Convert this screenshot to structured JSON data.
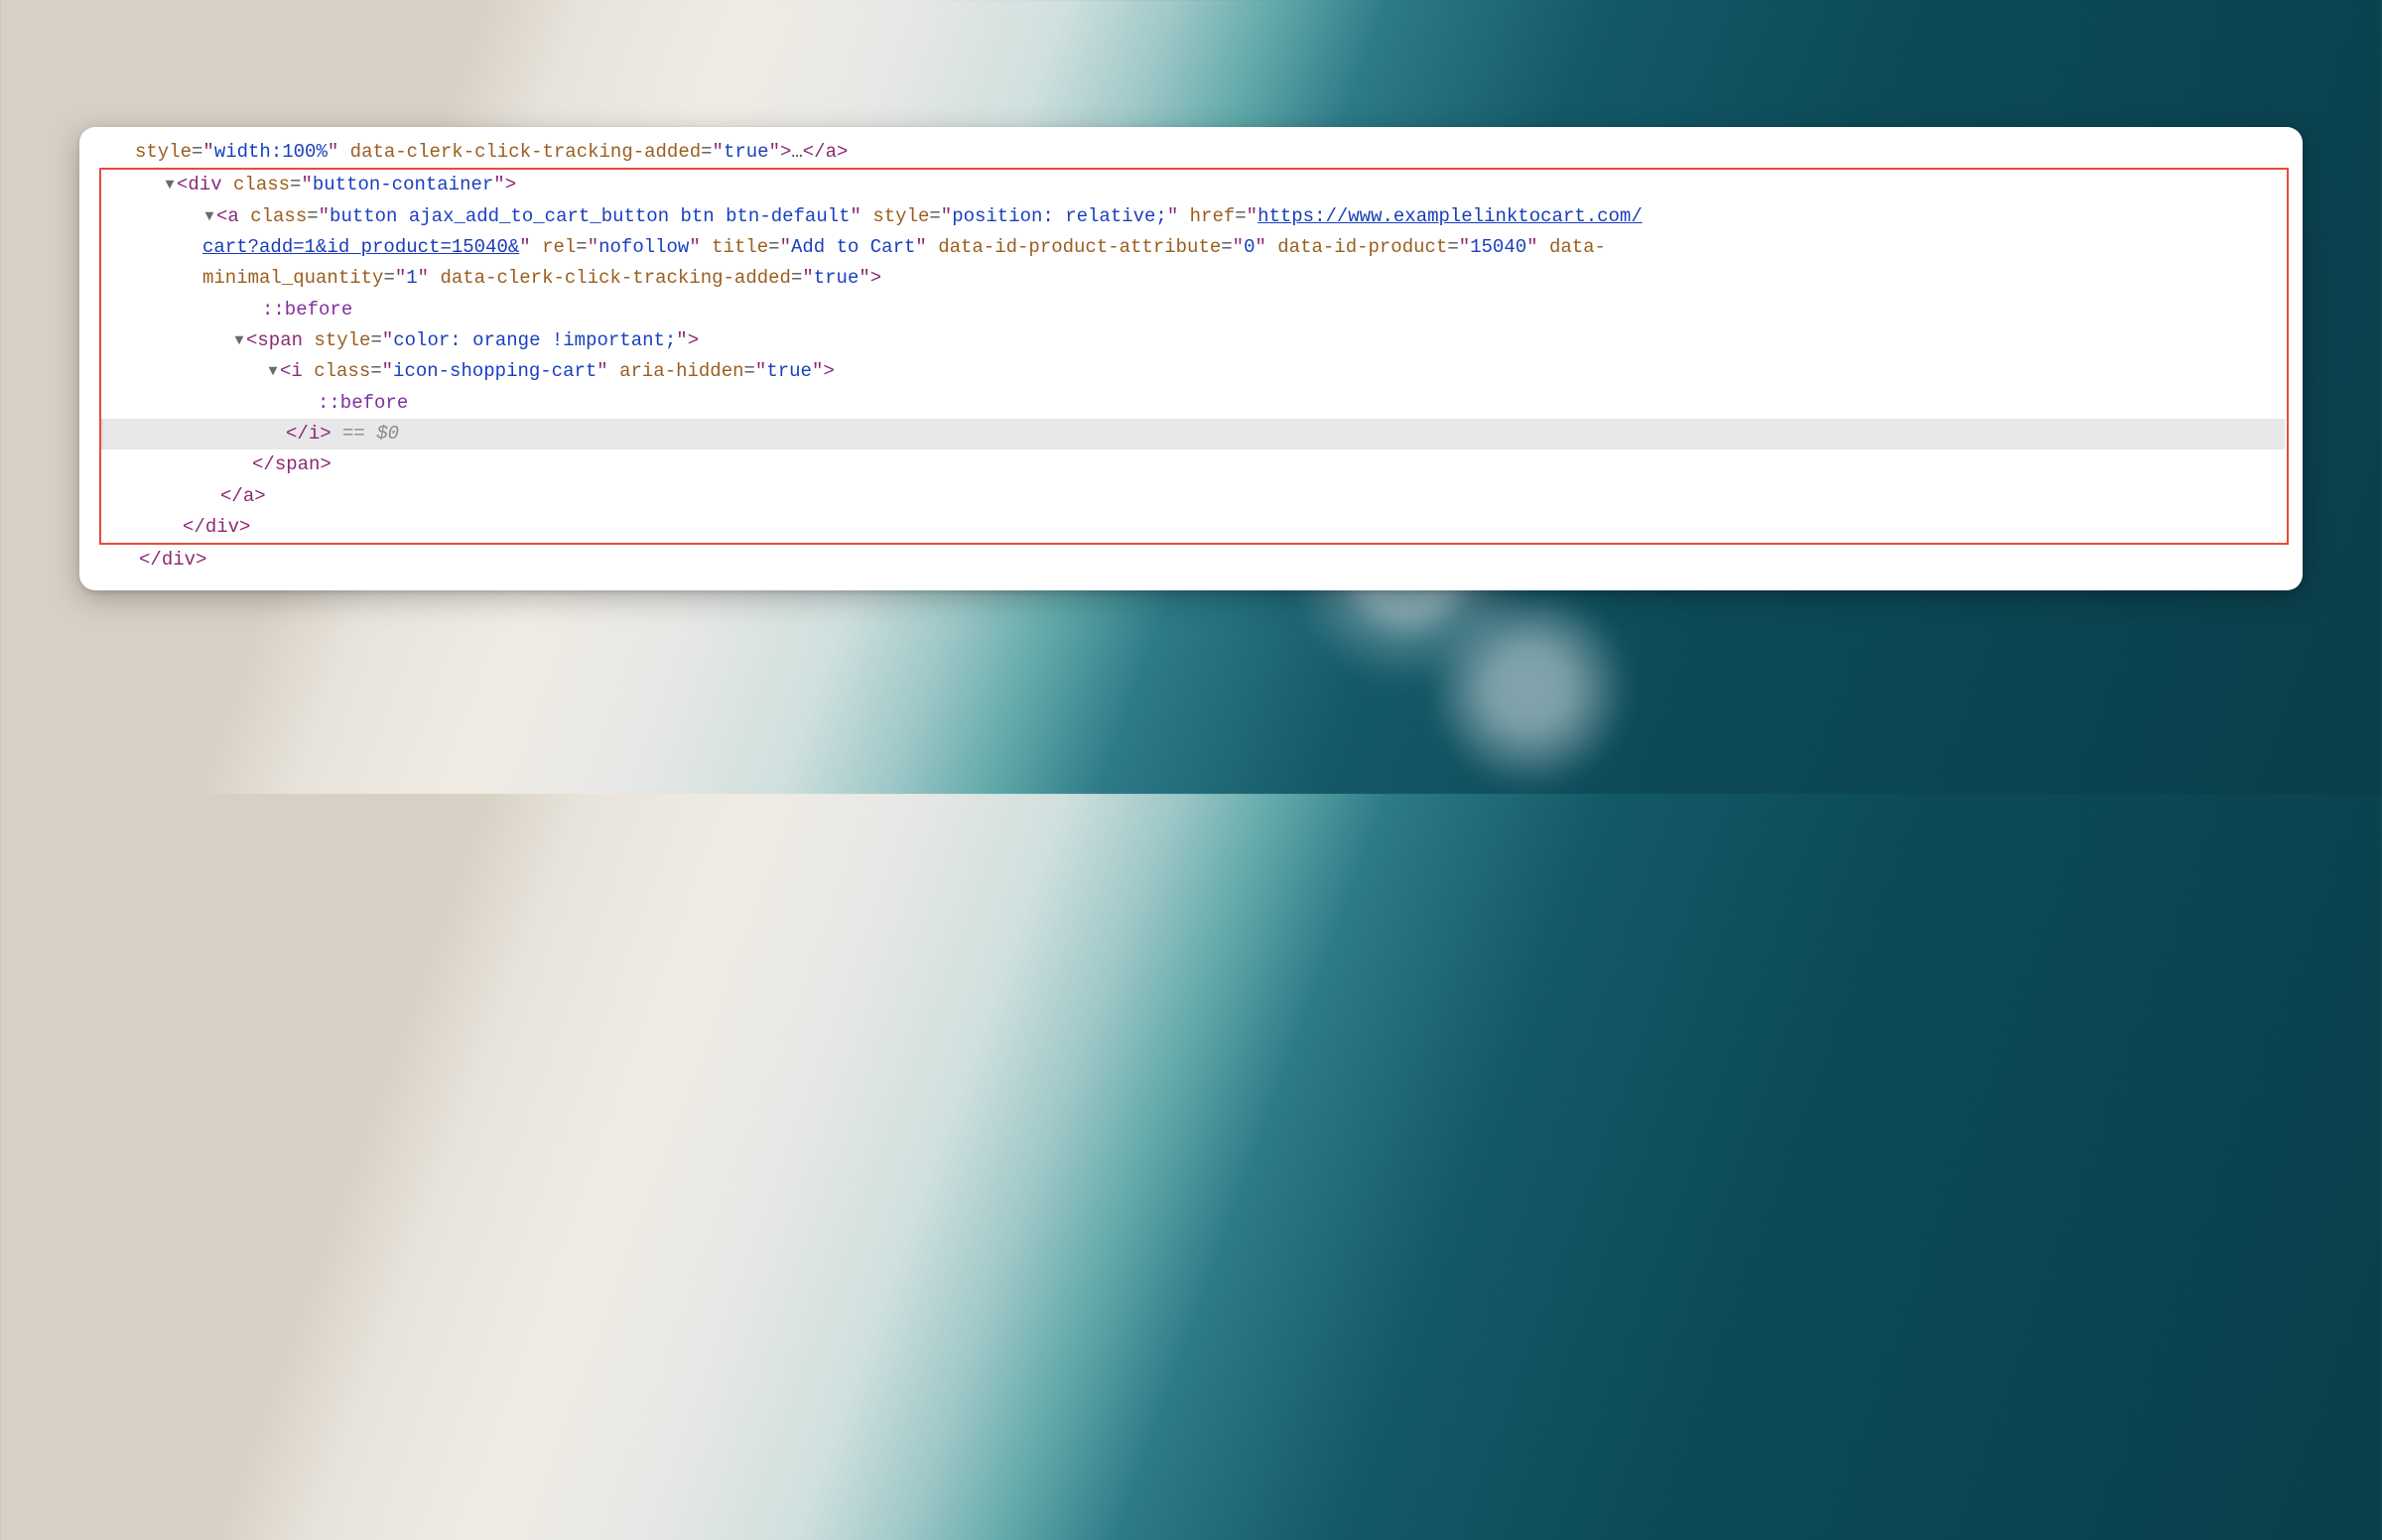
{
  "colors": {
    "tag": "#8a2a76",
    "attr": "#9b5e1e",
    "string": "#1a3fbf",
    "link": "#193db8",
    "pseudo": "#8030a0",
    "gray": "#8a8a8a",
    "highlightBorder": "#e94b3c",
    "selectedRowBg": "#e8e8e8"
  },
  "toggles": {
    "divButtonContainer": "▼",
    "anchor": "▼",
    "span": "▼",
    "iTag": "▼"
  },
  "line0": {
    "attr_style": "style",
    "val_style": "width:100%",
    "attr_tracking": "data-clerk-click-tracking-added",
    "val_tracking": "true",
    "ellipsis": "…",
    "close_a": "a"
  },
  "div_open": {
    "tag": "div",
    "attr_class": "class",
    "val_class": "button-container"
  },
  "anchor": {
    "tag": "a",
    "attr_class": "class",
    "val_class": "button ajax_add_to_cart_button btn btn-default",
    "attr_style": "style",
    "val_style": "position: relative;",
    "attr_href": "href",
    "href_display_1": "https://www.examplelinktocart.com/",
    "href_display_2": "cart?add=1&id_product=15040&",
    "attr_rel": "rel",
    "val_rel": "nofollow",
    "attr_title": "title",
    "val_title": "Add to Cart",
    "attr_dipa": "data-id-product-attribute",
    "val_dipa": "0",
    "attr_dip": "data-id-product",
    "val_dip": "15040",
    "attr_dmq": "data-",
    "attr_dmq2": "minimal_quantity",
    "val_dmq": "1",
    "attr_track": "data-clerk-click-tracking-added",
    "val_track": "true"
  },
  "pseudo": "::before",
  "span": {
    "tag": "span",
    "attr_style": "style",
    "val_style": "color: orange !important;"
  },
  "itag": {
    "tag": "i",
    "attr_class": "class",
    "val_class": "icon-shopping-cart",
    "attr_aria": "aria-hidden",
    "val_aria": "true"
  },
  "close": {
    "i": "i",
    "span": "span",
    "a": "a",
    "div": "div"
  },
  "selected_marker": "== $0"
}
